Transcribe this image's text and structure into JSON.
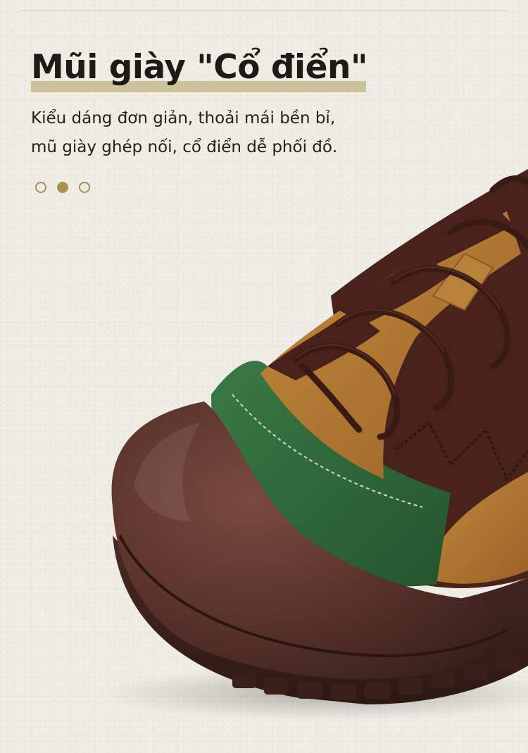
{
  "title": "Mũi giày \"Cổ điển\"",
  "description": {
    "line1": "Kiểu dáng đơn giản, thoải mái bền bỉ,",
    "line2": "mũ giày ghép nối, cổ điển dễ phối đồ."
  },
  "carousel": {
    "slide_count": 3,
    "active_index": 1
  },
  "colors": {
    "accent": "#a8924f",
    "underline": "#cdc39a",
    "text": "#1c1b18",
    "toe_cap": "#5a342d",
    "suede_green": "#2f6b3b",
    "leather_tan": "#b07a34",
    "upper_brown": "#4a221c"
  }
}
